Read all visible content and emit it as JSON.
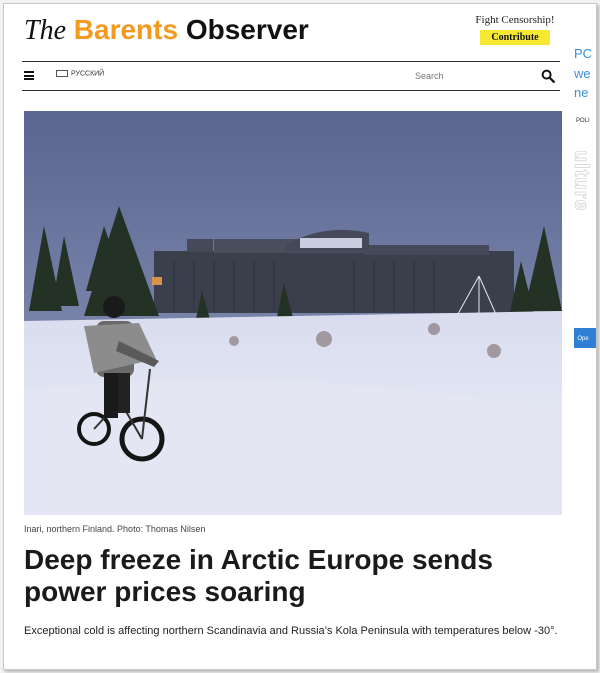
{
  "header": {
    "logo": {
      "the": "The",
      "barents": "Barents",
      "observer": "Observer"
    },
    "fight_text": "Fight Censorship!",
    "contribute_label": "Contribute"
  },
  "nav": {
    "language_label": "РУССКИЙ",
    "search_placeholder": "Search"
  },
  "side": {
    "text_lines": [
      "PC",
      "we",
      "ne"
    ],
    "small_text": "POLI",
    "vertical_text": "ulture",
    "button_label": "Ope"
  },
  "article": {
    "image_caption": "Inari, northern Finland. Photo: Thomas Nilsen",
    "headline": "Deep freeze in Arctic Europe sends power prices soaring",
    "subheadline": "Exceptional cold is affecting northern Scandinavia and Russia’s Kola Peninsula with temperatures below -30°."
  },
  "colors": {
    "brand_orange": "#f39a1e",
    "contribute_yellow": "#f5e830",
    "side_blue": "#3a8edc"
  }
}
